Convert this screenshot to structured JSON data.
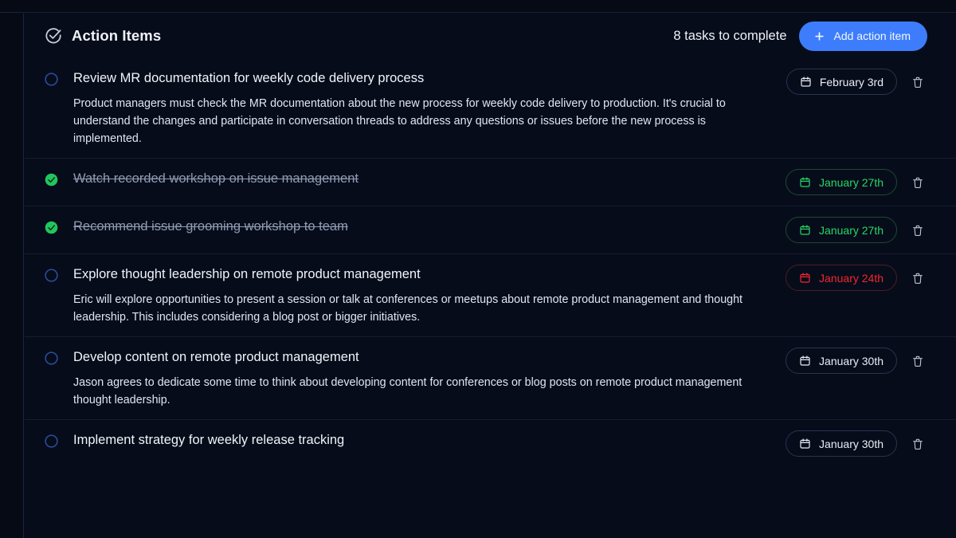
{
  "header": {
    "icon": "circle-check-icon",
    "title": "Action Items",
    "task_count_label": "8 tasks to complete",
    "add_button_label": "Add action item",
    "add_button_icon": "plus-icon",
    "add_button_color": "#3d7dfc"
  },
  "colors": {
    "background": "#060b18",
    "panel": "#070c1a",
    "rail": "#050a15",
    "divider": "#141d30",
    "accent_blue": "#3d7dfc",
    "checkbox_outline": "#2b4d9e",
    "done_green": "#22c55e",
    "date_default": "#e8eef8",
    "date_green": "#27d765",
    "date_red": "#f4262f",
    "title_text": "#f0f4fa",
    "done_text": "#8e9cb3",
    "desc_text": "#dfe6f1"
  },
  "icons": {
    "calendar": "calendar-icon",
    "trash": "trash-icon",
    "checkbox_empty": "checkbox-empty-icon",
    "checkbox_checked": "checkbox-checked-icon"
  },
  "items": [
    {
      "title": "Review MR documentation for weekly code delivery process",
      "description": "Product managers must check the MR documentation about the new process for weekly code delivery to production. It's crucial to understand the changes and participate in conversation threads to address any questions or issues before the new process is implemented.",
      "date": "February 3rd",
      "date_state": "default",
      "done": false
    },
    {
      "title": "Watch recorded workshop on issue management",
      "description": "",
      "date": "January 27th",
      "date_state": "green",
      "done": true
    },
    {
      "title": "Recommend issue grooming workshop to team",
      "description": "",
      "date": "January 27th",
      "date_state": "green",
      "done": true
    },
    {
      "title": "Explore thought leadership on remote product management",
      "description": "Eric will explore opportunities to present a session or talk at conferences or meetups about remote product management and thought leadership. This includes considering a blog post or bigger initiatives.",
      "date": "January 24th",
      "date_state": "red",
      "done": false
    },
    {
      "title": "Develop content on remote product management",
      "description": "Jason agrees to dedicate some time to think about developing content for conferences or blog posts on remote product management thought leadership.",
      "date": "January 30th",
      "date_state": "default",
      "done": false
    },
    {
      "title": "Implement strategy for weekly release tracking",
      "description": "",
      "date": "January 30th",
      "date_state": "default",
      "done": false
    }
  ]
}
